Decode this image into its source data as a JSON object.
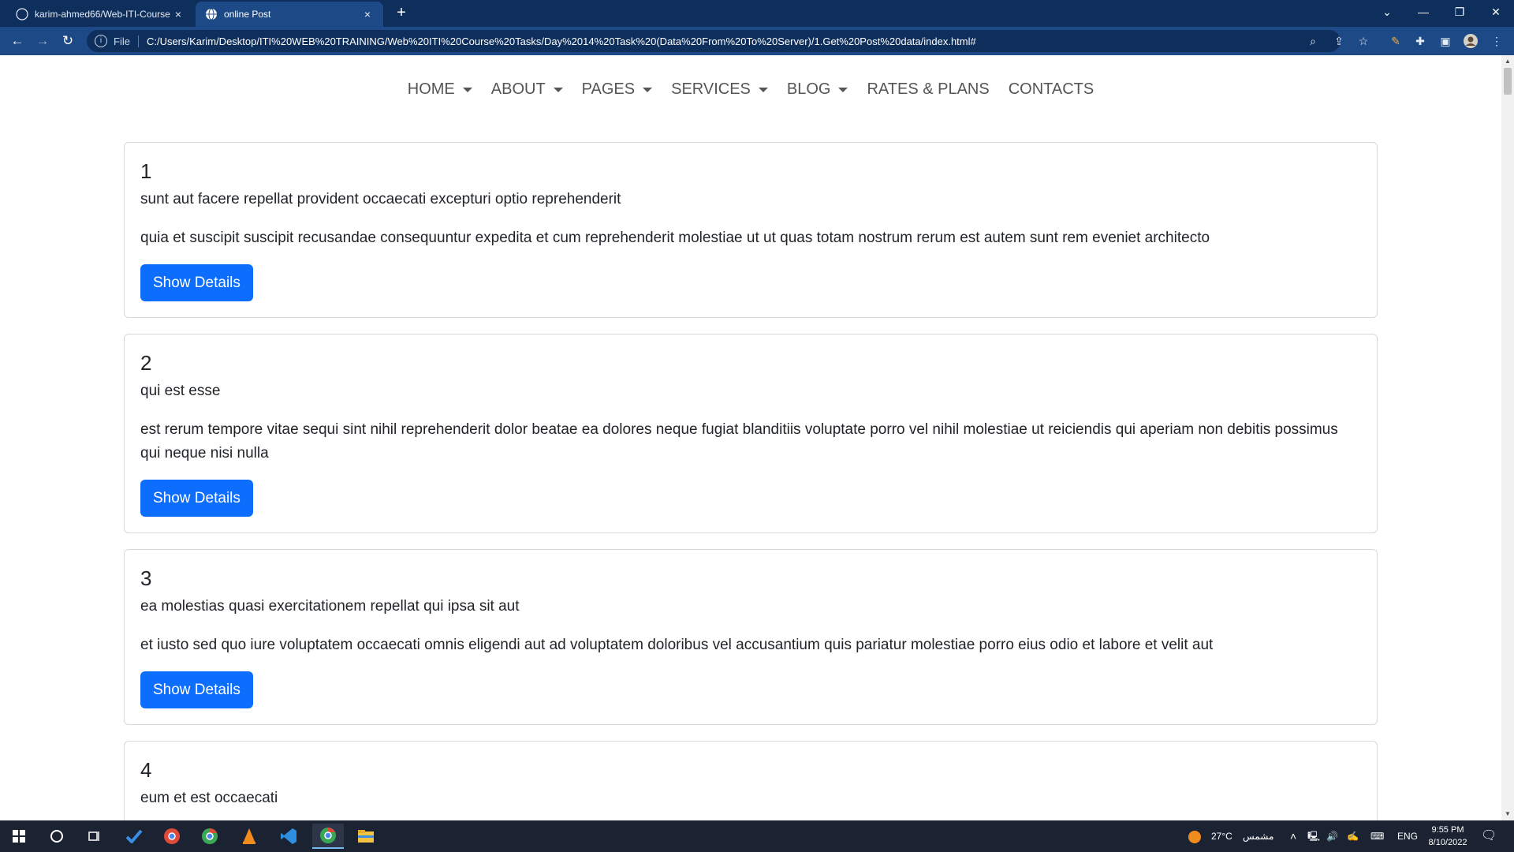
{
  "browser": {
    "tabs": [
      {
        "title": "karim-ahmed66/Web-ITI-Course",
        "close": "×"
      },
      {
        "title": "online Post",
        "close": "×"
      }
    ],
    "new_tab": "+",
    "window_controls": {
      "minimize": "—",
      "restore": "❐",
      "close": "✕"
    },
    "nav": {
      "back": "←",
      "forward": "→",
      "reload": "↻"
    },
    "address": {
      "scheme_label": "File",
      "url": "C:/Users/Karim/Desktop/ITI%20WEB%20TRAINING/Web%20ITI%20Course%20Tasks/Day%2014%20Task%20(Data%20From%20To%20Server)/1.Get%20Post%20data/index.html#"
    },
    "toolbar_icons": [
      "zoom-icon",
      "share-icon",
      "star-icon",
      "pen-icon",
      "extensions-icon",
      "sidepanel-icon",
      "profile-icon",
      "menu-icon"
    ]
  },
  "nav_menu": [
    {
      "label": "HOME",
      "dropdown": true
    },
    {
      "label": "ABOUT",
      "dropdown": true
    },
    {
      "label": "PAGES",
      "dropdown": true
    },
    {
      "label": "SERVICES",
      "dropdown": true
    },
    {
      "label": "BLOG",
      "dropdown": true
    },
    {
      "label": "RATES & PLANS",
      "dropdown": false
    },
    {
      "label": "CONTACTS",
      "dropdown": false
    }
  ],
  "posts": [
    {
      "id": "1",
      "title": "sunt aut facere repellat provident occaecati excepturi optio reprehenderit",
      "body": "quia et suscipit suscipit recusandae consequuntur expedita et cum reprehenderit molestiae ut ut quas totam nostrum rerum est autem sunt rem eveniet architecto",
      "button": "Show Details"
    },
    {
      "id": "2",
      "title": "qui est esse",
      "body": "est rerum tempore vitae sequi sint nihil reprehenderit dolor beatae ea dolores neque fugiat blanditiis voluptate porro vel nihil molestiae ut reiciendis qui aperiam non debitis possimus qui neque nisi nulla",
      "button": "Show Details"
    },
    {
      "id": "3",
      "title": "ea molestias quasi exercitationem repellat qui ipsa sit aut",
      "body": "et iusto sed quo iure voluptatem occaecati omnis eligendi aut ad voluptatem doloribus vel accusantium quis pariatur molestiae porro eius odio et labore et velit aut",
      "button": "Show Details"
    },
    {
      "id": "4",
      "title": "eum et est occaecati",
      "body": "",
      "button": ""
    }
  ],
  "taskbar": {
    "weather": "27°C",
    "weather_label": "مشمس",
    "language": "ENG",
    "time": "9:55 PM",
    "date": "8/10/2022"
  },
  "colors": {
    "primary_button": "#0d6efd",
    "tabbar": "#0e2f5c",
    "addressbar": "#1d4a86",
    "taskbar": "#1b2332"
  }
}
